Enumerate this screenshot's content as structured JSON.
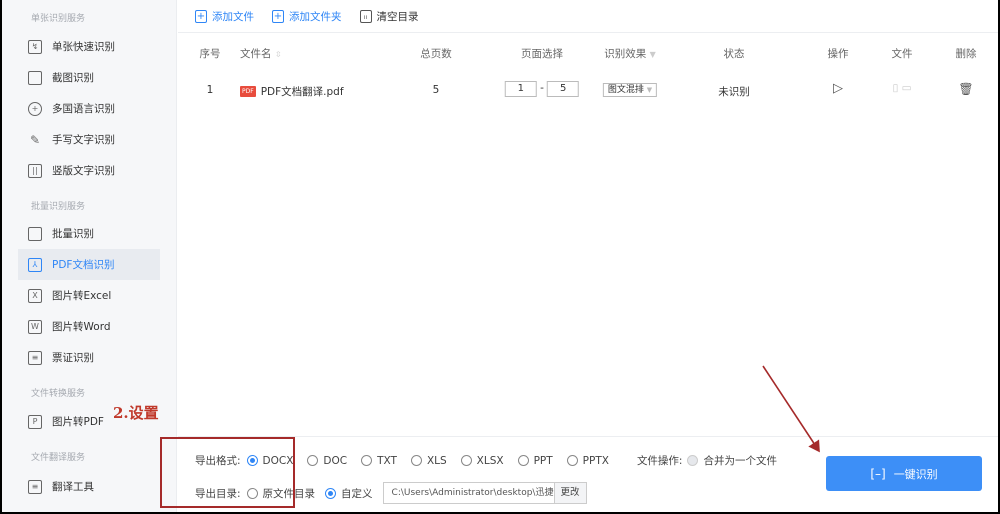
{
  "sidebar": {
    "sections": [
      "单张识别服务",
      "批量识别服务",
      "文件转换服务",
      "文件翻译服务"
    ],
    "items": [
      {
        "label": "单张快速识别",
        "icon": "quick-scan-icon"
      },
      {
        "label": "截图识别",
        "icon": "crop-icon"
      },
      {
        "label": "多国语言识别",
        "icon": "globe-icon"
      },
      {
        "label": "手写文字识别",
        "icon": "pen-icon"
      },
      {
        "label": "竖版文字识别",
        "icon": "vertical-text-icon"
      },
      {
        "label": "批量识别",
        "icon": "batch-icon"
      },
      {
        "label": "PDF文档识别",
        "icon": "pdf-icon",
        "active": true
      },
      {
        "label": "图片转Excel",
        "icon": "excel-icon"
      },
      {
        "label": "图片转Word",
        "icon": "word-icon"
      },
      {
        "label": "票证识别",
        "icon": "ticket-icon"
      },
      {
        "label": "图片转PDF",
        "icon": "pdf-convert-icon"
      },
      {
        "label": "翻译工具",
        "icon": "translate-icon"
      }
    ]
  },
  "toolbar": {
    "add_file": "添加文件",
    "add_folder": "添加文件夹",
    "clear": "清空目录"
  },
  "table": {
    "headers": [
      "序号",
      "文件名",
      "总页数",
      "页面选择",
      "识别效果",
      "状态",
      "操作",
      "文件",
      "删除"
    ],
    "rows": [
      {
        "index": "1",
        "name": "PDF文档翻译.pdf",
        "pages": "5",
        "from": "1",
        "sep": "-",
        "to": "5",
        "effect": "图文混排",
        "status": "未识别"
      }
    ]
  },
  "bottom": {
    "format_label": "导出格式:",
    "formats": [
      "DOCX",
      "DOC",
      "TXT",
      "XLS",
      "XLSX",
      "PPT",
      "PPTX"
    ],
    "selected_format": "DOCX",
    "file_op_label": "文件操作:",
    "merge_label": "合并为一个文件",
    "dir_label": "导出目录:",
    "dir_options": [
      "原文件目录",
      "自定义"
    ],
    "selected_dir": "自定义",
    "path": "C:\\Users\\Administrator\\desktop\\迅捷OCR文",
    "change": "更改",
    "start": "一键识别"
  },
  "annotation": {
    "text": "2.设置",
    "color": "#c0392b"
  },
  "colors": {
    "accent": "#3d8ff7"
  }
}
